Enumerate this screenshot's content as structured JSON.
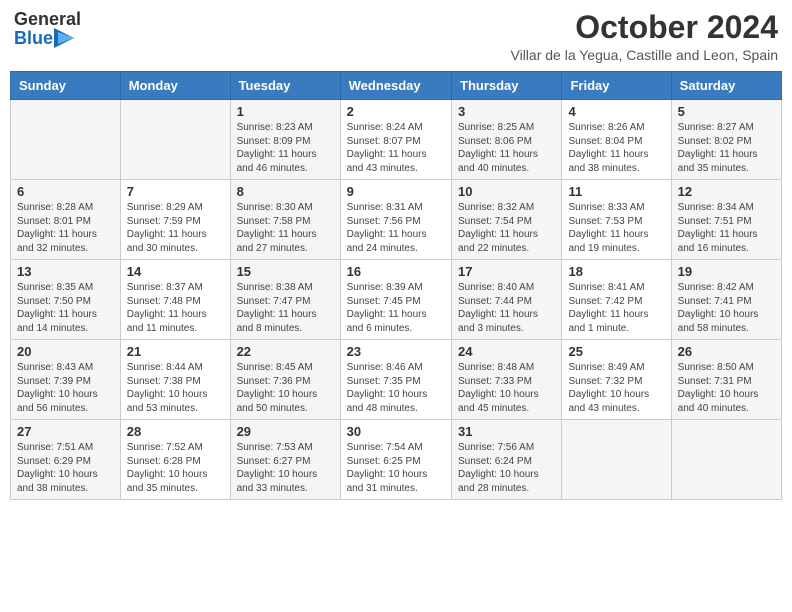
{
  "header": {
    "logo_general": "General",
    "logo_blue": "Blue",
    "month_title": "October 2024",
    "subtitle": "Villar de la Yegua, Castille and Leon, Spain"
  },
  "weekdays": [
    "Sunday",
    "Monday",
    "Tuesday",
    "Wednesday",
    "Thursday",
    "Friday",
    "Saturday"
  ],
  "weeks": [
    [
      {
        "day": "",
        "sunrise": "",
        "sunset": "",
        "daylight": ""
      },
      {
        "day": "",
        "sunrise": "",
        "sunset": "",
        "daylight": ""
      },
      {
        "day": "1",
        "sunrise": "Sunrise: 8:23 AM",
        "sunset": "Sunset: 8:09 PM",
        "daylight": "Daylight: 11 hours and 46 minutes."
      },
      {
        "day": "2",
        "sunrise": "Sunrise: 8:24 AM",
        "sunset": "Sunset: 8:07 PM",
        "daylight": "Daylight: 11 hours and 43 minutes."
      },
      {
        "day": "3",
        "sunrise": "Sunrise: 8:25 AM",
        "sunset": "Sunset: 8:06 PM",
        "daylight": "Daylight: 11 hours and 40 minutes."
      },
      {
        "day": "4",
        "sunrise": "Sunrise: 8:26 AM",
        "sunset": "Sunset: 8:04 PM",
        "daylight": "Daylight: 11 hours and 38 minutes."
      },
      {
        "day": "5",
        "sunrise": "Sunrise: 8:27 AM",
        "sunset": "Sunset: 8:02 PM",
        "daylight": "Daylight: 11 hours and 35 minutes."
      }
    ],
    [
      {
        "day": "6",
        "sunrise": "Sunrise: 8:28 AM",
        "sunset": "Sunset: 8:01 PM",
        "daylight": "Daylight: 11 hours and 32 minutes."
      },
      {
        "day": "7",
        "sunrise": "Sunrise: 8:29 AM",
        "sunset": "Sunset: 7:59 PM",
        "daylight": "Daylight: 11 hours and 30 minutes."
      },
      {
        "day": "8",
        "sunrise": "Sunrise: 8:30 AM",
        "sunset": "Sunset: 7:58 PM",
        "daylight": "Daylight: 11 hours and 27 minutes."
      },
      {
        "day": "9",
        "sunrise": "Sunrise: 8:31 AM",
        "sunset": "Sunset: 7:56 PM",
        "daylight": "Daylight: 11 hours and 24 minutes."
      },
      {
        "day": "10",
        "sunrise": "Sunrise: 8:32 AM",
        "sunset": "Sunset: 7:54 PM",
        "daylight": "Daylight: 11 hours and 22 minutes."
      },
      {
        "day": "11",
        "sunrise": "Sunrise: 8:33 AM",
        "sunset": "Sunset: 7:53 PM",
        "daylight": "Daylight: 11 hours and 19 minutes."
      },
      {
        "day": "12",
        "sunrise": "Sunrise: 8:34 AM",
        "sunset": "Sunset: 7:51 PM",
        "daylight": "Daylight: 11 hours and 16 minutes."
      }
    ],
    [
      {
        "day": "13",
        "sunrise": "Sunrise: 8:35 AM",
        "sunset": "Sunset: 7:50 PM",
        "daylight": "Daylight: 11 hours and 14 minutes."
      },
      {
        "day": "14",
        "sunrise": "Sunrise: 8:37 AM",
        "sunset": "Sunset: 7:48 PM",
        "daylight": "Daylight: 11 hours and 11 minutes."
      },
      {
        "day": "15",
        "sunrise": "Sunrise: 8:38 AM",
        "sunset": "Sunset: 7:47 PM",
        "daylight": "Daylight: 11 hours and 8 minutes."
      },
      {
        "day": "16",
        "sunrise": "Sunrise: 8:39 AM",
        "sunset": "Sunset: 7:45 PM",
        "daylight": "Daylight: 11 hours and 6 minutes."
      },
      {
        "day": "17",
        "sunrise": "Sunrise: 8:40 AM",
        "sunset": "Sunset: 7:44 PM",
        "daylight": "Daylight: 11 hours and 3 minutes."
      },
      {
        "day": "18",
        "sunrise": "Sunrise: 8:41 AM",
        "sunset": "Sunset: 7:42 PM",
        "daylight": "Daylight: 11 hours and 1 minute."
      },
      {
        "day": "19",
        "sunrise": "Sunrise: 8:42 AM",
        "sunset": "Sunset: 7:41 PM",
        "daylight": "Daylight: 10 hours and 58 minutes."
      }
    ],
    [
      {
        "day": "20",
        "sunrise": "Sunrise: 8:43 AM",
        "sunset": "Sunset: 7:39 PM",
        "daylight": "Daylight: 10 hours and 56 minutes."
      },
      {
        "day": "21",
        "sunrise": "Sunrise: 8:44 AM",
        "sunset": "Sunset: 7:38 PM",
        "daylight": "Daylight: 10 hours and 53 minutes."
      },
      {
        "day": "22",
        "sunrise": "Sunrise: 8:45 AM",
        "sunset": "Sunset: 7:36 PM",
        "daylight": "Daylight: 10 hours and 50 minutes."
      },
      {
        "day": "23",
        "sunrise": "Sunrise: 8:46 AM",
        "sunset": "Sunset: 7:35 PM",
        "daylight": "Daylight: 10 hours and 48 minutes."
      },
      {
        "day": "24",
        "sunrise": "Sunrise: 8:48 AM",
        "sunset": "Sunset: 7:33 PM",
        "daylight": "Daylight: 10 hours and 45 minutes."
      },
      {
        "day": "25",
        "sunrise": "Sunrise: 8:49 AM",
        "sunset": "Sunset: 7:32 PM",
        "daylight": "Daylight: 10 hours and 43 minutes."
      },
      {
        "day": "26",
        "sunrise": "Sunrise: 8:50 AM",
        "sunset": "Sunset: 7:31 PM",
        "daylight": "Daylight: 10 hours and 40 minutes."
      }
    ],
    [
      {
        "day": "27",
        "sunrise": "Sunrise: 7:51 AM",
        "sunset": "Sunset: 6:29 PM",
        "daylight": "Daylight: 10 hours and 38 minutes."
      },
      {
        "day": "28",
        "sunrise": "Sunrise: 7:52 AM",
        "sunset": "Sunset: 6:28 PM",
        "daylight": "Daylight: 10 hours and 35 minutes."
      },
      {
        "day": "29",
        "sunrise": "Sunrise: 7:53 AM",
        "sunset": "Sunset: 6:27 PM",
        "daylight": "Daylight: 10 hours and 33 minutes."
      },
      {
        "day": "30",
        "sunrise": "Sunrise: 7:54 AM",
        "sunset": "Sunset: 6:25 PM",
        "daylight": "Daylight: 10 hours and 31 minutes."
      },
      {
        "day": "31",
        "sunrise": "Sunrise: 7:56 AM",
        "sunset": "Sunset: 6:24 PM",
        "daylight": "Daylight: 10 hours and 28 minutes."
      },
      {
        "day": "",
        "sunrise": "",
        "sunset": "",
        "daylight": ""
      },
      {
        "day": "",
        "sunrise": "",
        "sunset": "",
        "daylight": ""
      }
    ]
  ]
}
